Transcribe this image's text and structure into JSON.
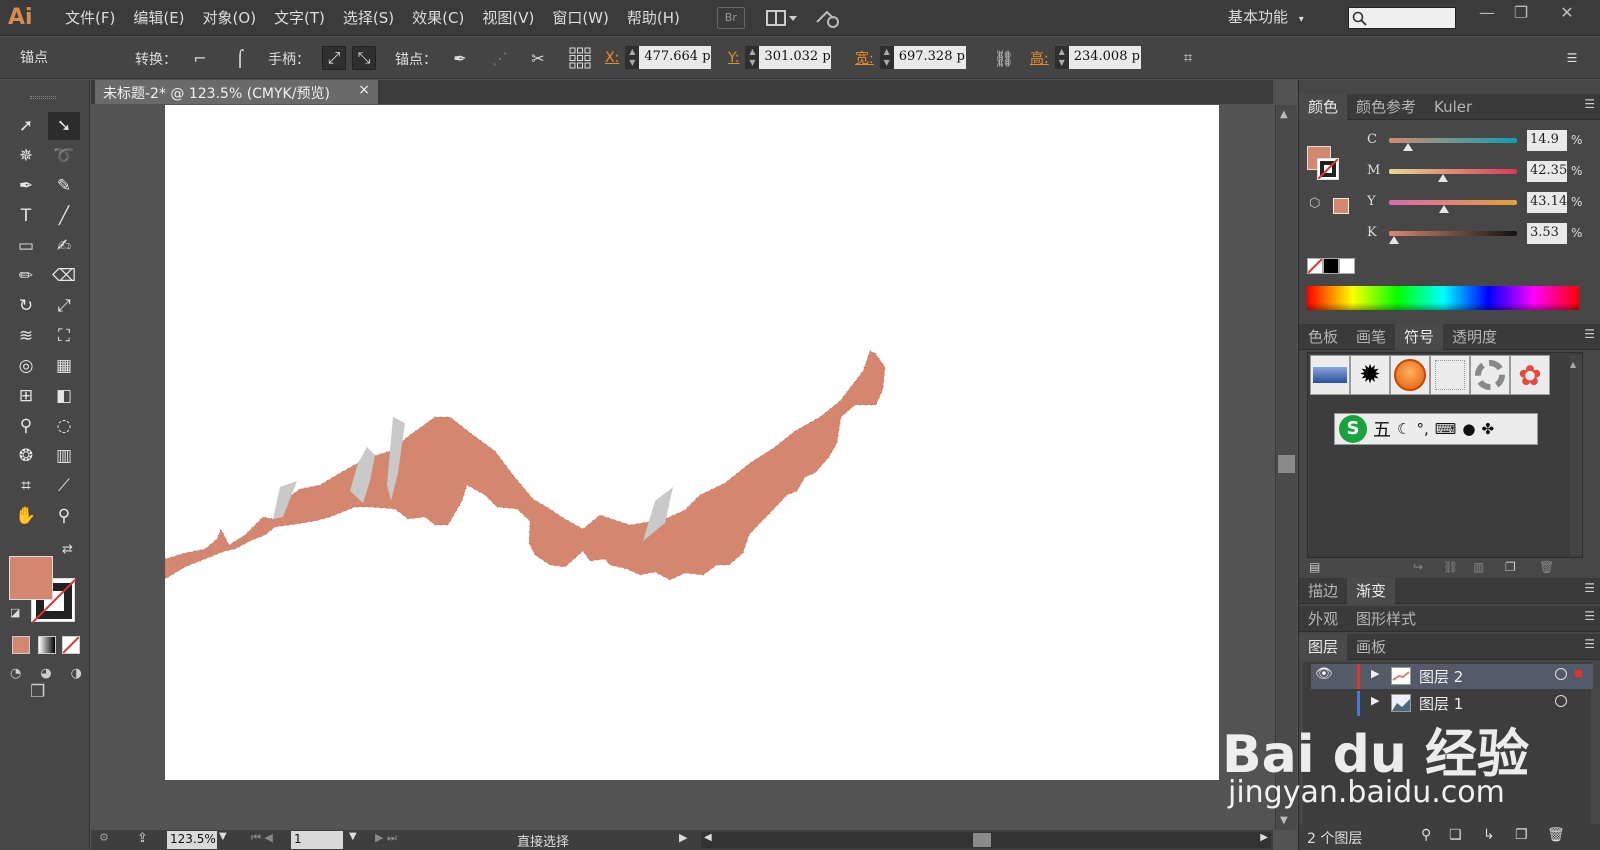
{
  "app": {
    "logo": "Ai",
    "workspace_label": "基本功能",
    "workspace_arrow": "▾",
    "br_label": "Br"
  },
  "menus": [
    "文件(F)",
    "编辑(E)",
    "对象(O)",
    "文字(T)",
    "选择(S)",
    "效果(C)",
    "视图(V)",
    "窗口(W)",
    "帮助(H)"
  ],
  "control": {
    "anchor_label": "锚点",
    "convert_label": "转换：",
    "handle_label": "手柄：",
    "anchors_label": "锚点：",
    "x_label": "X:",
    "x_value": "477.664 p",
    "y_label": "Y:",
    "y_value": "301.032 p",
    "w_label": "宽:",
    "w_value": "697.328 p",
    "h_label": "高:",
    "h_value": "234.008 p"
  },
  "document": {
    "tab_title": "未标题-2* @ 123.5% (CMYK/预览)",
    "close": "×"
  },
  "status": {
    "zoom": "123.5%",
    "page": "1",
    "tool_name": "直接选择"
  },
  "colors": {
    "fill": "#d4876f",
    "artwork": "#d4866e",
    "artwork_outline": "#c25a5a",
    "patch": "#c9c9c9",
    "accent": "#e88d2a"
  },
  "color_panel": {
    "tabs": [
      "颜色",
      "颜色参考",
      "Kuler"
    ],
    "channels": [
      {
        "name": "C",
        "value": "14.9",
        "fraction": 0.149
      },
      {
        "name": "M",
        "value": "42.35",
        "fraction": 0.4235
      },
      {
        "name": "Y",
        "value": "43.14",
        "fraction": 0.4314
      },
      {
        "name": "K",
        "value": "3.53",
        "fraction": 0.0353
      }
    ],
    "pct": "%"
  },
  "swatch_panel": {
    "tabs": [
      "色板",
      "画笔",
      "符号",
      "透明度"
    ],
    "sogou_char": "五"
  },
  "stroke_panel": {
    "tabs": [
      "描边",
      "渐变"
    ]
  },
  "appearance_panel": {
    "tabs": [
      "外观",
      "图形样式"
    ]
  },
  "layers_panel": {
    "tabs": [
      "图层",
      "画板"
    ],
    "layers": [
      {
        "name": "图层 2"
      },
      {
        "name": "图层 1"
      }
    ],
    "count_label": "2 个图层"
  },
  "watermark": {
    "brand": "Bai du 经验",
    "url": "jingyan.baidu.com"
  }
}
